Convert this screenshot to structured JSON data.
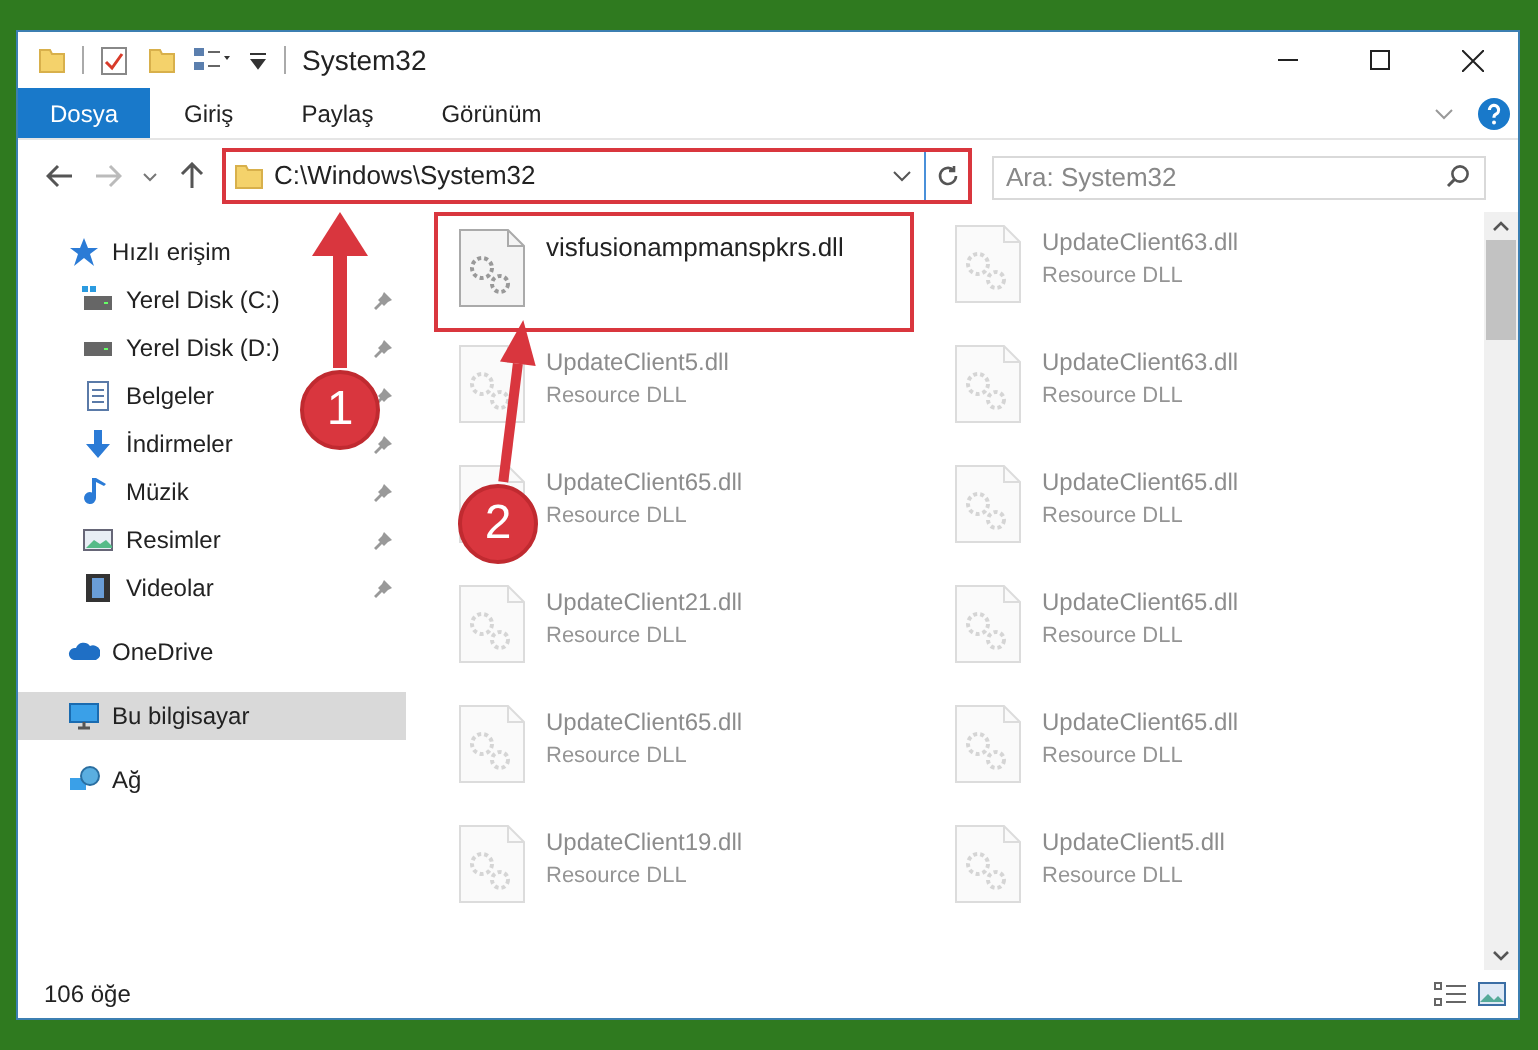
{
  "window": {
    "title": "System32"
  },
  "ribbon_tabs": [
    {
      "label": "Dosya",
      "selected": true
    },
    {
      "label": "Giriş",
      "selected": false
    },
    {
      "label": "Paylaş",
      "selected": false
    },
    {
      "label": "Görünüm",
      "selected": false
    }
  ],
  "address": {
    "path": "C:\\Windows\\System32",
    "highlighted": true
  },
  "search": {
    "placeholder": "Ara: System32"
  },
  "sidebar": {
    "items": [
      {
        "label": "Hızlı erişim",
        "kind": "quick",
        "pinned": false,
        "selected": false,
        "children": [
          {
            "label": "Yerel Disk (C:)",
            "kind": "diskc",
            "pinned": true,
            "selected": false
          },
          {
            "label": "Yerel Disk (D:)",
            "kind": "disk",
            "pinned": true,
            "selected": false
          },
          {
            "label": "Belgeler",
            "kind": "docs",
            "pinned": true,
            "selected": false
          },
          {
            "label": "İndirmeler",
            "kind": "downloads",
            "pinned": true,
            "selected": false
          },
          {
            "label": "Müzik",
            "kind": "music",
            "pinned": true,
            "selected": false
          },
          {
            "label": "Resimler",
            "kind": "pictures",
            "pinned": true,
            "selected": false
          },
          {
            "label": "Videolar",
            "kind": "videos",
            "pinned": true,
            "selected": false
          }
        ]
      },
      {
        "label": "OneDrive",
        "kind": "cloud",
        "pinned": false,
        "selected": false
      },
      {
        "label": "Bu bilgisayar",
        "kind": "pc",
        "pinned": false,
        "selected": true
      },
      {
        "label": "Ağ",
        "kind": "network",
        "pinned": false,
        "selected": false
      }
    ]
  },
  "files": [
    {
      "name": "visfusionampmanspkrs.dll",
      "highlighted": true,
      "faded": false
    },
    {
      "name": "UpdateClient63.dll",
      "type": "Resource DLL",
      "highlighted": false,
      "faded": true
    },
    {
      "name": "UpdateClient5.dll",
      "type": "Resource DLL",
      "highlighted": false,
      "faded": true
    },
    {
      "name": "UpdateClient63.dll",
      "type": "Resource DLL",
      "highlighted": false,
      "faded": true
    },
    {
      "name": "UpdateClient65.dll",
      "type": "Resource DLL",
      "highlighted": false,
      "faded": true
    },
    {
      "name": "UpdateClient65.dll",
      "type": "Resource DLL",
      "highlighted": false,
      "faded": true
    },
    {
      "name": "UpdateClient21.dll",
      "type": "Resource DLL",
      "highlighted": false,
      "faded": true
    },
    {
      "name": "UpdateClient65.dll",
      "type": "Resource DLL",
      "highlighted": false,
      "faded": true
    },
    {
      "name": "UpdateClient65.dll",
      "type": "Resource DLL",
      "highlighted": false,
      "faded": true
    },
    {
      "name": "UpdateClient65.dll",
      "type": "Resource DLL",
      "highlighted": false,
      "faded": true
    },
    {
      "name": "UpdateClient19.dll",
      "type": "Resource DLL",
      "highlighted": false,
      "faded": true
    },
    {
      "name": "UpdateClient5.dll",
      "type": "Resource DLL",
      "highlighted": false,
      "faded": true
    }
  ],
  "annotations": [
    {
      "label": "1"
    },
    {
      "label": "2"
    }
  ],
  "status_bar": {
    "count": "106 öğe"
  }
}
